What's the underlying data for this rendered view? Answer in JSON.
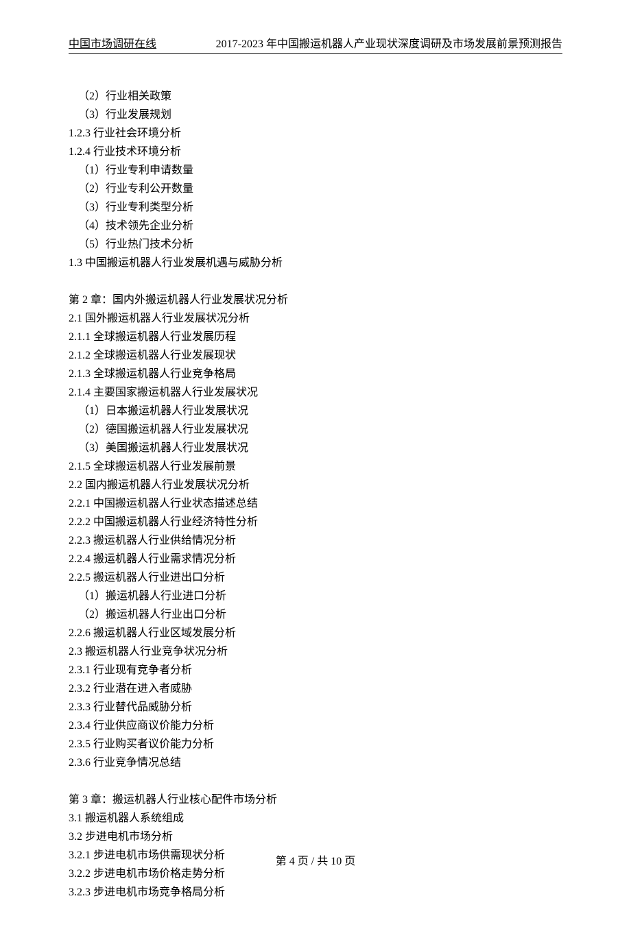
{
  "header": {
    "left": "中国市场调研在线",
    "right": "2017-2023 年中国搬运机器人产业现状深度调研及市场发展前景预测报告"
  },
  "toc": [
    {
      "text": "（2）行业相关政策",
      "indent": true
    },
    {
      "text": "（3）行业发展规划",
      "indent": true
    },
    {
      "text": "1.2.3 行业社会环境分析",
      "indent": false
    },
    {
      "text": "1.2.4 行业技术环境分析",
      "indent": false
    },
    {
      "text": "（1）行业专利申请数量",
      "indent": true
    },
    {
      "text": "（2）行业专利公开数量",
      "indent": true
    },
    {
      "text": "（3）行业专利类型分析",
      "indent": true
    },
    {
      "text": "（4）技术领先企业分析",
      "indent": true
    },
    {
      "text": "（5）行业热门技术分析",
      "indent": true
    },
    {
      "text": "1.3 中国搬运机器人行业发展机遇与威胁分析",
      "indent": false
    },
    {
      "blank": true
    },
    {
      "text": "第 2 章：国内外搬运机器人行业发展状况分析",
      "indent": false
    },
    {
      "text": "2.1 国外搬运机器人行业发展状况分析",
      "indent": false
    },
    {
      "text": "2.1.1 全球搬运机器人行业发展历程",
      "indent": false
    },
    {
      "text": "2.1.2 全球搬运机器人行业发展现状",
      "indent": false
    },
    {
      "text": "2.1.3 全球搬运机器人行业竞争格局",
      "indent": false
    },
    {
      "text": "2.1.4 主要国家搬运机器人行业发展状况",
      "indent": false
    },
    {
      "text": "（1）日本搬运机器人行业发展状况",
      "indent": true
    },
    {
      "text": "（2）德国搬运机器人行业发展状况",
      "indent": true
    },
    {
      "text": "（3）美国搬运机器人行业发展状况",
      "indent": true
    },
    {
      "text": "2.1.5 全球搬运机器人行业发展前景",
      "indent": false
    },
    {
      "text": "2.2 国内搬运机器人行业发展状况分析",
      "indent": false
    },
    {
      "text": "2.2.1 中国搬运机器人行业状态描述总结",
      "indent": false
    },
    {
      "text": "2.2.2 中国搬运机器人行业经济特性分析",
      "indent": false
    },
    {
      "text": "2.2.3 搬运机器人行业供给情况分析",
      "indent": false
    },
    {
      "text": "2.2.4 搬运机器人行业需求情况分析",
      "indent": false
    },
    {
      "text": "2.2.5 搬运机器人行业进出口分析",
      "indent": false
    },
    {
      "text": "（1）搬运机器人行业进口分析",
      "indent": true
    },
    {
      "text": "（2）搬运机器人行业出口分析",
      "indent": true
    },
    {
      "text": "2.2.6 搬运机器人行业区域发展分析",
      "indent": false
    },
    {
      "text": "2.3 搬运机器人行业竞争状况分析",
      "indent": false
    },
    {
      "text": "2.3.1 行业现有竞争者分析",
      "indent": false
    },
    {
      "text": "2.3.2 行业潜在进入者威胁",
      "indent": false
    },
    {
      "text": "2.3.3 行业替代品威胁分析",
      "indent": false
    },
    {
      "text": "2.3.4 行业供应商议价能力分析",
      "indent": false
    },
    {
      "text": "2.3.5 行业购买者议价能力分析",
      "indent": false
    },
    {
      "text": "2.3.6 行业竞争情况总结",
      "indent": false
    },
    {
      "blank": true
    },
    {
      "text": "第 3 章：搬运机器人行业核心配件市场分析",
      "indent": false
    },
    {
      "text": "3.1 搬运机器人系统组成",
      "indent": false
    },
    {
      "text": "3.2 步进电机市场分析",
      "indent": false
    },
    {
      "text": "3.2.1 步进电机市场供需现状分析",
      "indent": false
    },
    {
      "text": "3.2.2 步进电机市场价格走势分析",
      "indent": false
    },
    {
      "text": "3.2.3 步进电机市场竞争格局分析",
      "indent": false
    }
  ],
  "footer": "第 4 页 / 共 10 页"
}
